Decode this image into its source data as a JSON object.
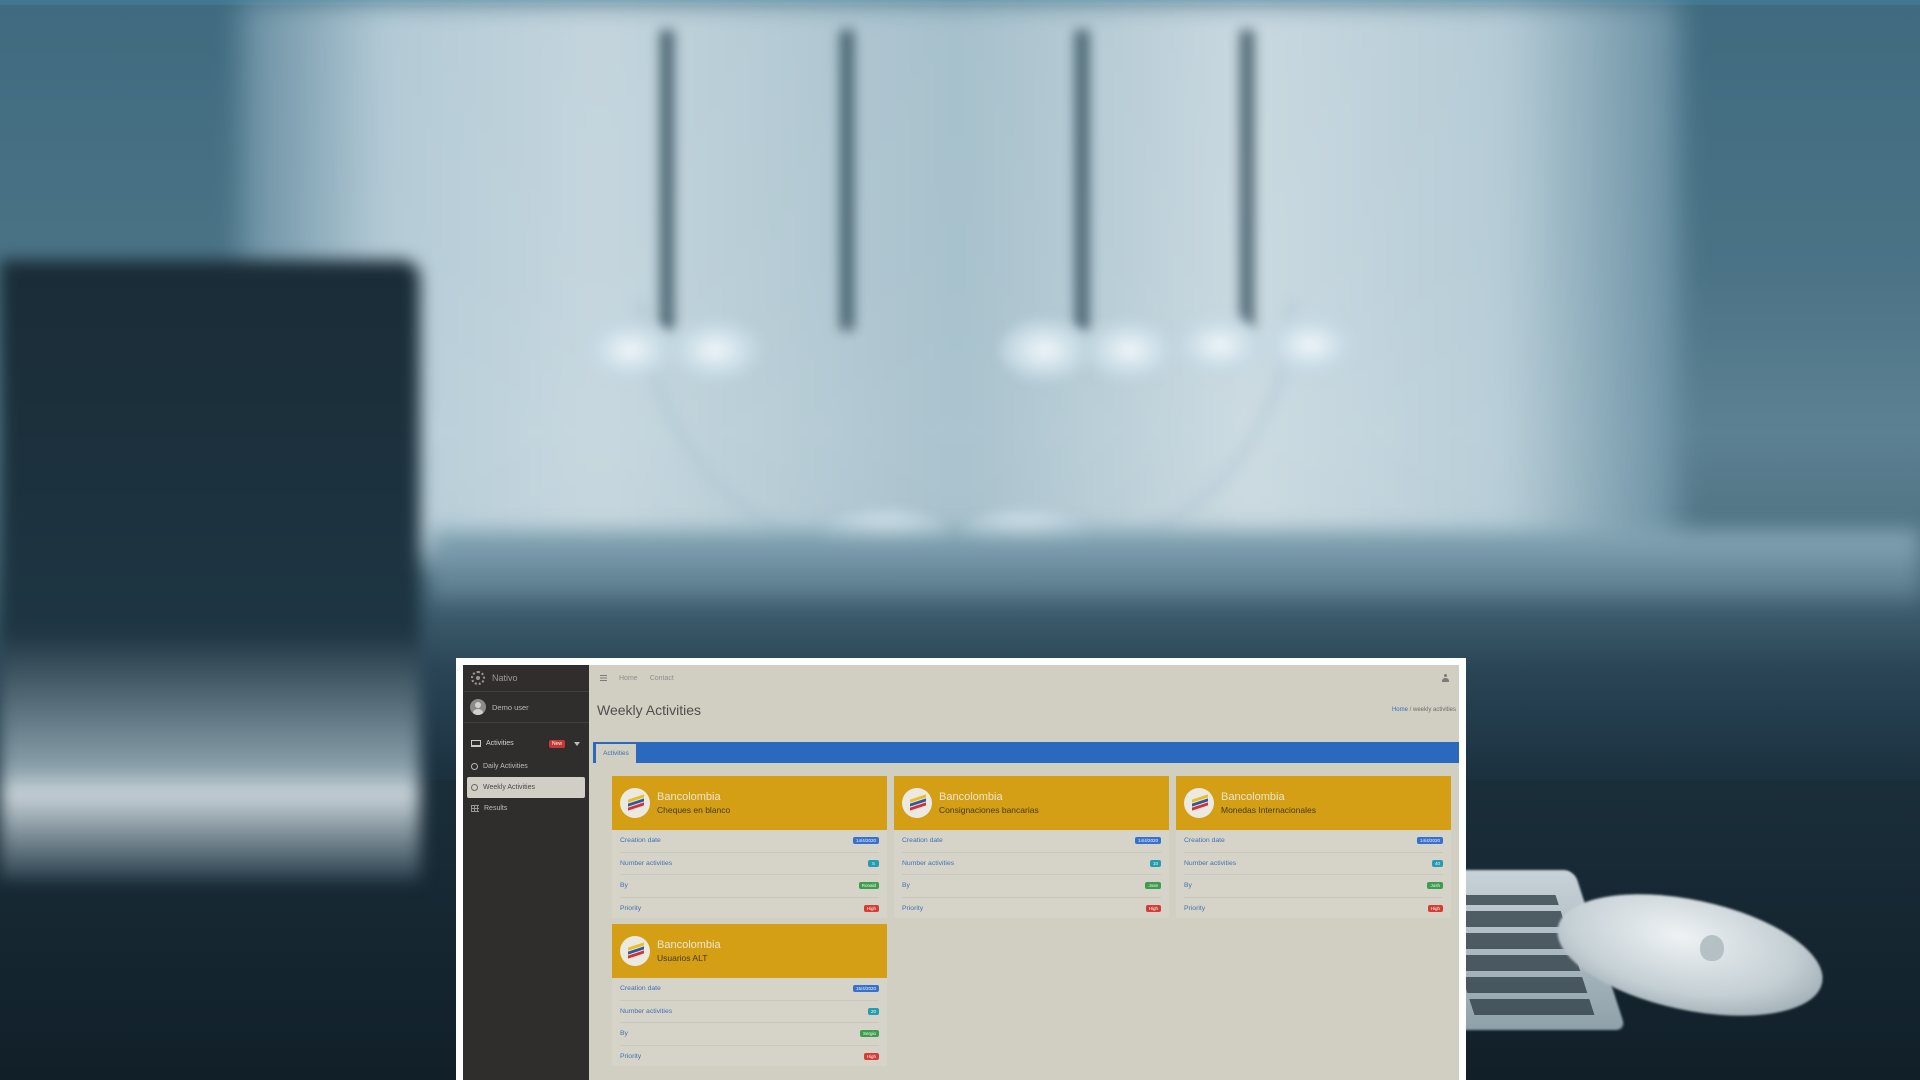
{
  "app": {
    "brand": "Nativo",
    "user_name": "Demo user",
    "topbar": {
      "home": "Home",
      "contact": "Contact"
    },
    "page_title": "Weekly Activities",
    "breadcrumb": {
      "home": "Home",
      "separator": " / ",
      "current": "weekly activities"
    },
    "tab_label": "Activities"
  },
  "sidebar": {
    "activities": {
      "label": "Activities",
      "badge": "New"
    },
    "items": [
      {
        "label": "Daily Activities"
      },
      {
        "label": "Weekly Activities"
      },
      {
        "label": "Results"
      }
    ]
  },
  "card_labels": {
    "creation_date": "Creation date",
    "number_activities": "Number activities",
    "by": "By",
    "priority": "Priority"
  },
  "cards": [
    {
      "bank": "Bancolombia",
      "title": "Cheques en blanco",
      "date": "14/4/2020",
      "count": "5",
      "by": "Ronald",
      "priority": "High"
    },
    {
      "bank": "Bancolombia",
      "title": "Consignaciones bancarias",
      "date": "14/4/2020",
      "count": "10",
      "by": "Jose",
      "priority": "High"
    },
    {
      "bank": "Bancolombia",
      "title": "Monedas Internacionales",
      "date": "14/4/2020",
      "count": "40",
      "by": "Josh",
      "priority": "High"
    },
    {
      "bank": "Bancolombia",
      "title": "Usuarios ALT",
      "date": "15/4/2020",
      "count": "20",
      "by": "Sergio",
      "priority": "High"
    }
  ],
  "colors": {
    "accent_blue": "#2166c4",
    "card_header": "#d9a00c",
    "badge_new": "#c9302c",
    "pill_date": "#2f6fd6",
    "pill_count": "#1c9fb6",
    "pill_by": "#34a04a",
    "pill_priority": "#d9362e"
  }
}
